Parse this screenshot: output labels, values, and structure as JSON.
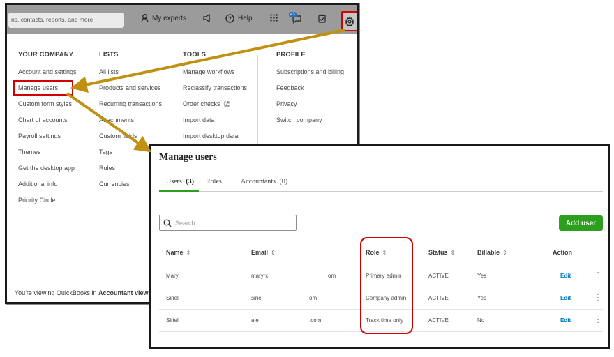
{
  "topbar": {
    "search_text": "ns, contacts, reports, and more",
    "my_experts": "My experts",
    "help": "Help",
    "badge_count": "43"
  },
  "menu": {
    "columns": [
      {
        "header": "YOUR COMPANY",
        "items": [
          "Account and settings",
          "Manage users",
          "Custom form styles",
          "Chart of accounts",
          "Payroll settings",
          "Themes",
          "Get the desktop app",
          "Additional info",
          "Priority Circle"
        ]
      },
      {
        "header": "LISTS",
        "items": [
          "All lists",
          "Products and services",
          "Recurring transactions",
          "Attachments",
          "Custom fields",
          "Tags",
          "Rules",
          "Currencies"
        ]
      },
      {
        "header": "TOOLS",
        "items": [
          "Manage workflows",
          "Reclassify transactions",
          "Order checks",
          "Import data",
          "Import desktop data"
        ]
      },
      {
        "header": "PROFILE",
        "items": [
          "Subscriptions and billing",
          "Feedback",
          "Privacy",
          "Switch company"
        ]
      }
    ],
    "footer_prefix": "You're viewing QuickBooks in ",
    "footer_bold": "Accountant view"
  },
  "manage": {
    "title": "Manage users",
    "tabs": [
      {
        "label": "Users",
        "count": "(3)"
      },
      {
        "label": "Roles",
        "count": ""
      },
      {
        "label": "Accountants",
        "count": "(0)"
      }
    ],
    "search_placeholder": "Search...",
    "add_user": "Add user",
    "columns": [
      "Name",
      "Email",
      "Role",
      "Status",
      "Billable",
      "Action"
    ],
    "sort_glyph": "⇕",
    "rows": [
      {
        "name": "Mary",
        "email": "maryrc",
        "email_end": "om",
        "role": "Primary admin",
        "status": "ACTIVE",
        "billable": "Yes",
        "action": "Edit"
      },
      {
        "name": "Siriel",
        "email": "siriel",
        "email_end": "om",
        "role": "Company admin",
        "status": "ACTIVE",
        "billable": "Yes",
        "action": "Edit"
      },
      {
        "name": "Siriel",
        "email": "ale",
        "email_end": ".com",
        "role": "Track time only",
        "status": "ACTIVE",
        "billable": "No",
        "action": "Edit"
      }
    ]
  },
  "colors": {
    "highlight": "#d00000",
    "arrow": "#c09010",
    "brand_green": "#2ca01c",
    "link_blue": "#0077c5"
  }
}
